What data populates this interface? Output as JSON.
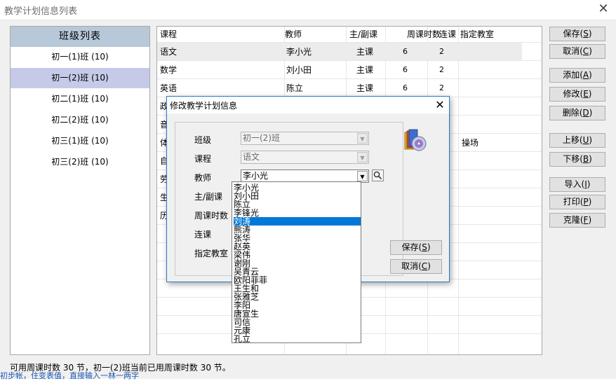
{
  "window": {
    "title": "教学计划信息列表"
  },
  "class_list": {
    "header": "班级列表",
    "items": [
      "初一(1)班 (10)",
      "初一(2)班 (10)",
      "初二(1)班 (10)",
      "初二(2)班 (10)",
      "初三(1)班 (10)",
      "初三(2)班 (10)"
    ],
    "selected": "初一(2)班 (10)"
  },
  "grid": {
    "columns": [
      "课程",
      "教师",
      "主/副课",
      "周课时数",
      "连课",
      "指定教室"
    ],
    "rows": [
      {
        "course": "语文",
        "teacher": "李小光",
        "type": "主课",
        "hours": "6",
        "consecutive": "2",
        "room": ""
      },
      {
        "course": "数学",
        "teacher": "刘小田",
        "type": "主课",
        "hours": "6",
        "consecutive": "2",
        "room": ""
      },
      {
        "course": "英语",
        "teacher": "陈立",
        "type": "主课",
        "hours": "6",
        "consecutive": "2",
        "room": ""
      },
      {
        "course": "政",
        "teacher": "",
        "type": "",
        "hours": "",
        "consecutive": "",
        "room": ""
      },
      {
        "course": "音",
        "teacher": "",
        "type": "",
        "hours": "",
        "consecutive": "",
        "room": ""
      },
      {
        "course": "体",
        "teacher": "",
        "type": "",
        "hours": "",
        "consecutive": "",
        "room": "操场"
      },
      {
        "course": "自",
        "teacher": "",
        "type": "",
        "hours": "",
        "consecutive": "",
        "room": ""
      },
      {
        "course": "劳",
        "teacher": "",
        "type": "",
        "hours": "",
        "consecutive": "",
        "room": ""
      },
      {
        "course": "生",
        "teacher": "",
        "type": "",
        "hours": "",
        "consecutive": "",
        "room": ""
      },
      {
        "course": "历",
        "teacher": "",
        "type": "",
        "hours": "",
        "consecutive": "",
        "room": ""
      }
    ]
  },
  "buttons": {
    "save": {
      "label": "保存(",
      "key": "S",
      "end": ")"
    },
    "cancel": {
      "label": "取消(",
      "key": "C",
      "end": ")"
    },
    "add": {
      "label": "添加(",
      "key": "A",
      "end": ")"
    },
    "edit": {
      "label": "修改(",
      "key": "E",
      "end": ")"
    },
    "delete": {
      "label": "删除(",
      "key": "D",
      "end": ")"
    },
    "move_up": {
      "label": "上移(",
      "key": "U",
      "end": ")"
    },
    "move_down": {
      "label": "下移(",
      "key": "B",
      "end": ")"
    },
    "import": {
      "label": "导入(",
      "key": "I",
      "end": ")"
    },
    "print": {
      "label": "打印(",
      "key": "P",
      "end": ")"
    },
    "clone": {
      "label": "克隆(",
      "key": "F",
      "end": ")"
    }
  },
  "status_text": "可用周课时数 30 节，初一(2)班当前已用周课时数 30 节。",
  "bottom_fragment": "初步帐，住变表值，直接输入一林一两字",
  "dialog": {
    "title": "修改教学计划信息",
    "labels": {
      "class": "班级",
      "course": "课程",
      "teacher": "教师",
      "type": "主/副课",
      "hours": "周课时数",
      "consecutive": "连课",
      "room": "指定教室"
    },
    "values": {
      "class": "初一(2)班",
      "course": "语文",
      "teacher": "李小光"
    },
    "save": {
      "label": "保存(",
      "key": "S",
      "end": ")"
    },
    "cancel": {
      "label": "取消(",
      "key": "C",
      "end": ")"
    },
    "icons": {
      "search": "search-icon",
      "logo": "software-box-icon"
    }
  },
  "teacher_options": [
    "李小光",
    "刘小田",
    "陈立",
    "李锋光",
    "刘涛",
    "熊涛",
    "张华",
    "赵英",
    "梁伟",
    "谢刚",
    "吴青云",
    "欧阳菲菲",
    "王生和",
    "张雅芝",
    "李阳",
    "唐宣生",
    "司信",
    "元康",
    "孔立"
  ],
  "teacher_selected": "刘涛"
}
